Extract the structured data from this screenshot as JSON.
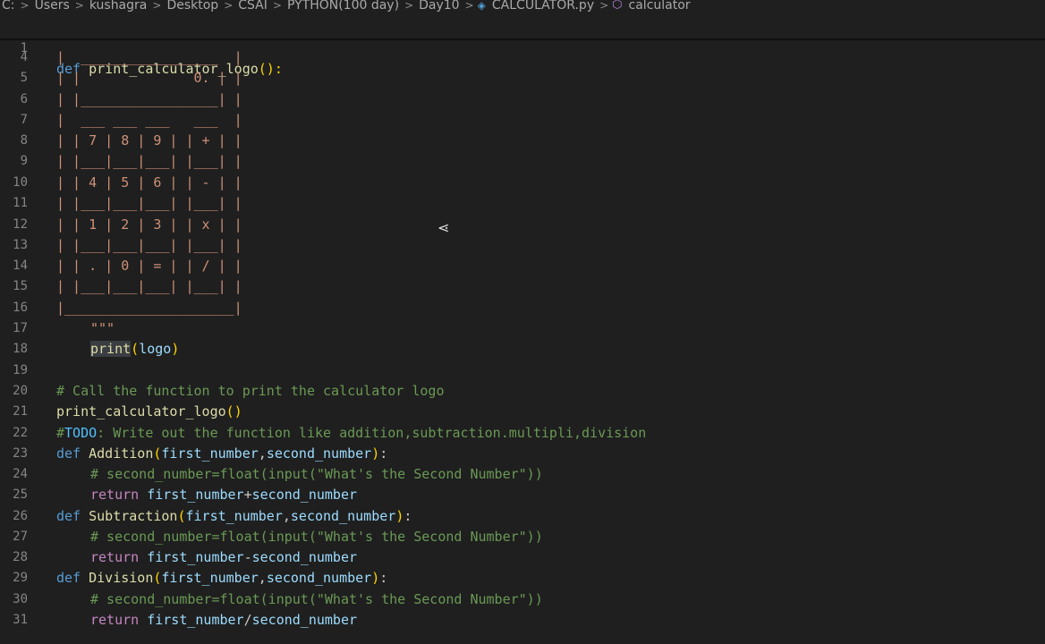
{
  "breadcrumb": {
    "items": [
      "C:",
      "Users",
      "kushagra",
      "Desktop",
      "CSAI",
      "PYTHON(100 day)",
      "Day10"
    ],
    "file": "CALCULATOR.py",
    "symbol": "calculator",
    "icons": {
      "file": "python-file-icon",
      "symbol": "symbol-module-icon"
    }
  },
  "editor": {
    "sticky_line": {
      "number": "1",
      "kw": "def",
      "fn": "print_calculator_logo",
      "rest": "():"
    },
    "logo_lines": [
      {
        "number": "4",
        "text": "|  _________________  |"
      },
      {
        "number": "5",
        "text": "| |              0. | |"
      },
      {
        "number": "6",
        "text": "| |_________________| |"
      },
      {
        "number": "7",
        "text": "|  ___ ___ ___   ___  |"
      },
      {
        "number": "8",
        "text": "| | 7 | 8 | 9 | | + | |"
      },
      {
        "number": "9",
        "text": "| |___|___|___| |___| |"
      },
      {
        "number": "10",
        "text": "| | 4 | 5 | 6 | | - | |"
      },
      {
        "number": "11",
        "text": "| |___|___|___| |___| |"
      },
      {
        "number": "12",
        "text": "| | 1 | 2 | 3 | | x | |"
      },
      {
        "number": "13",
        "text": "| |___|___|___| |___| |"
      },
      {
        "number": "14",
        "text": "| | . | 0 | = | | / | |"
      },
      {
        "number": "15",
        "text": "| |___|___|___| |___| |"
      },
      {
        "number": "16",
        "text": "|_____________________|"
      }
    ],
    "line17": {
      "number": "17",
      "text": "\"\"\""
    },
    "line18": {
      "number": "18",
      "fn": "print",
      "open": "(",
      "arg": "logo",
      "close": ")"
    },
    "line19": {
      "number": "19"
    },
    "line20": {
      "number": "20",
      "comment": "# Call the function to print the calculator logo"
    },
    "line21": {
      "number": "21",
      "fn": "print_calculator_logo",
      "parens": "()"
    },
    "line22": {
      "number": "22",
      "hash": "#",
      "todo": "TODO",
      "rest": ": Write out the function like addition,subtraction.multipli,division"
    },
    "functions": [
      {
        "def_number": "23",
        "name": "Addition",
        "p1": "first_number",
        "p2": "second_number",
        "comment_number": "24",
        "comment": "# second_number=float(input(\"What's the Second Number\"))",
        "return_number": "25",
        "op": "+"
      },
      {
        "def_number": "26",
        "name": "Subtraction",
        "p1": "first_number",
        "p2": "second_number",
        "comment_number": "27",
        "comment": "# second_number=float(input(\"What's the Second Number\"))",
        "return_number": "28",
        "op": "-"
      },
      {
        "def_number": "29",
        "name": "Division",
        "p1": "first_number",
        "p2": "second_number",
        "comment_number": "30",
        "comment": "# second_number=float(input(\"What's the Second Number\"))",
        "return_number": "31",
        "op": "/"
      }
    ],
    "kw_def": "def",
    "kw_return": "return"
  }
}
